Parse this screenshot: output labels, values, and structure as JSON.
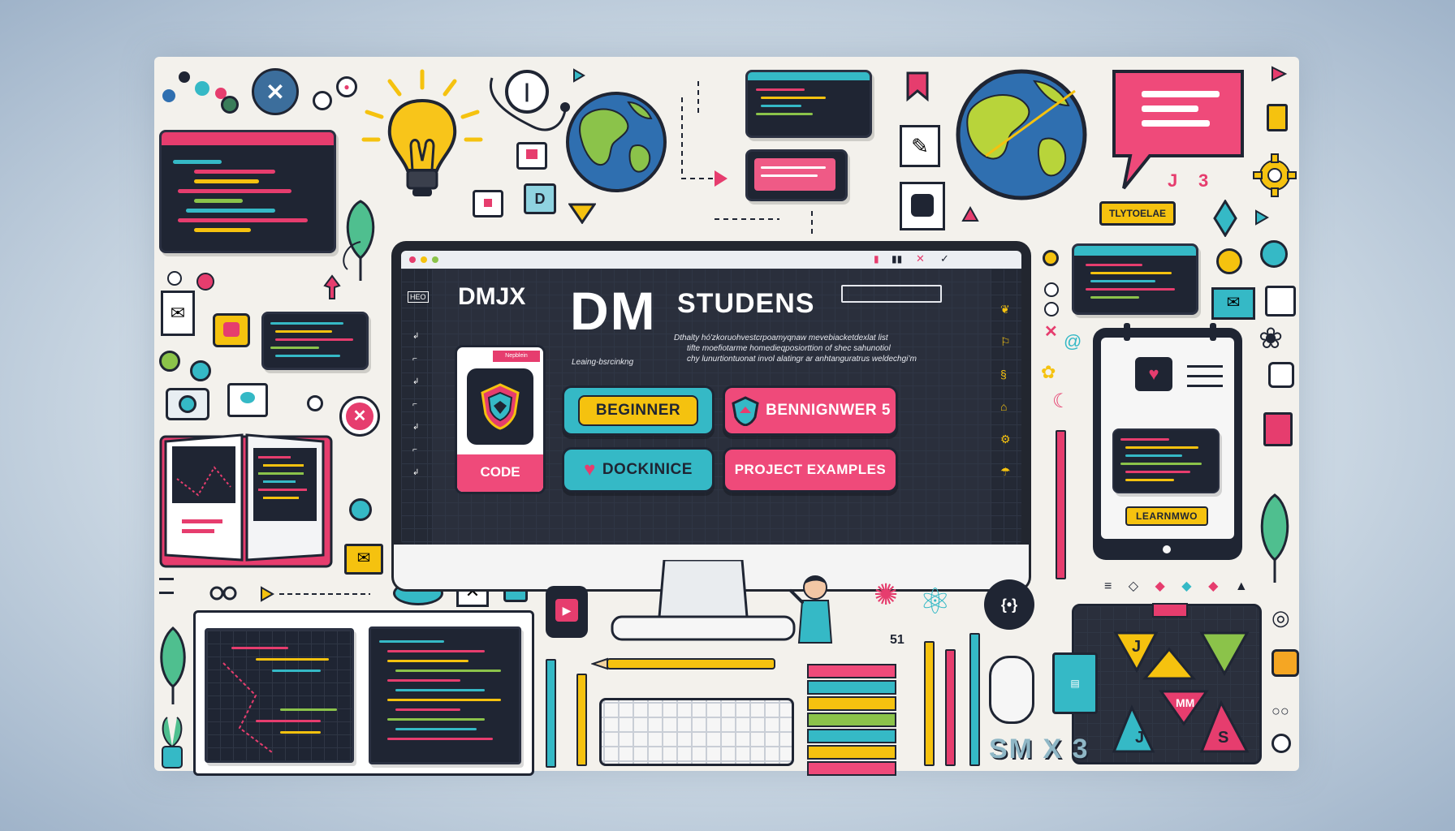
{
  "monitor": {
    "brand_left": "DMJX",
    "big_logo": "DM",
    "heading": "STUDENS",
    "description_lines": [
      "Dthalty hó'zkoruohvestcrpoamyqnaw mevebiacketdexlat list",
      "tifte moefiotarme homedieqposiorttion of shec sahunotiol",
      "chy lunurtiontuonat invol alatingr ar anhtanguratrus weldechgi’m"
    ],
    "card_caption": "Leaing-bsrcinkng",
    "card_badge": "Nepblein",
    "card_label": "CODE",
    "buttons": {
      "beginner": "BEGINNER",
      "bennignwer": "BENNIGNWER 5",
      "dockinice": "DOCKINICE",
      "project_examples": "PROJECT EXAMPLES"
    },
    "side_label": "HEO"
  },
  "signs": {
    "yellow_sign": "TLYTOELAE",
    "tablet_button": "LEARNMWO"
  },
  "letters": {
    "corner_text": "SM X 3",
    "tile_j1": "J",
    "tile_j2": "J",
    "tile_s": "S",
    "tile_m": "MM",
    "bubble_j": "J",
    "bubble_3": "3",
    "tiny_51": "51",
    "tiny_d": "D"
  },
  "colors": {
    "pink": "#e63d6e",
    "teal": "#35b9c6",
    "yellow": "#f5c20f",
    "navy": "#1f2533",
    "green": "#8bc34a"
  }
}
